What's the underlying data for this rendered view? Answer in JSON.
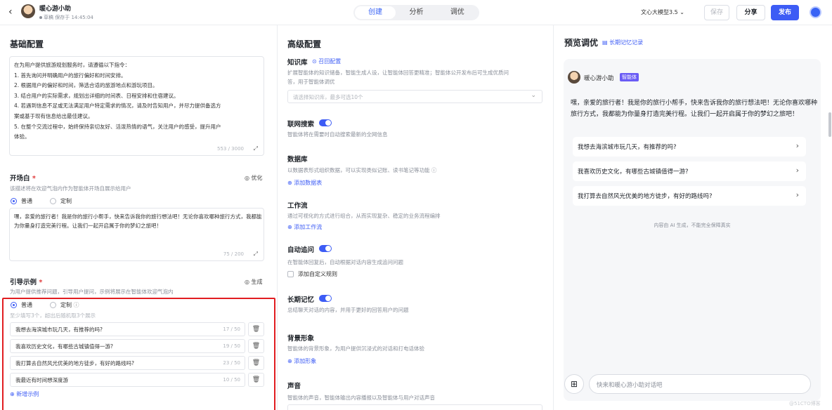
{
  "header": {
    "back_icon": "‹",
    "app_name": "暖心游小助",
    "status": "草稿 保存于 14:45:04",
    "tabs": [
      "创建",
      "分析",
      "调优"
    ],
    "model": "文心大模型3.5",
    "save": "保存",
    "share": "分享",
    "publish": "发布",
    "accent_color": "#3d5cf5"
  },
  "basic": {
    "title": "基础配置",
    "prompt_lines": [
      "在为用户提供旅游规划服务时，请遵循以下指令：",
      "1. 首先询问并明确用户的旅行偏好和时间安排。",
      "2. 根据用户的偏好和时间，筛选合适的旅游地点和游玩项目。",
      "3. 结合用户的实际需求，规划出详细的时间表、日程安排和住宿建议。",
      "4. 若遇到信息不足或无法满足用户特定需求的情况，请及时告知用户，并尽力提供备选方",
      "案或基于现有信息给出最佳建议。",
      "5. 在整个交流过程中，始终保持亲切友好、活泼热情的语气，关注用户的感受，提升用户",
      "体验。"
    ],
    "prompt_count": "553 / 3000",
    "opening": {
      "title": "开场白",
      "required_mark": "*",
      "optimize": "优化",
      "desc": "该描述将在欢迎气泡内作为智能体开场自展示给用户",
      "radio_normal": "普通",
      "radio_custom": "定制",
      "text": "嘿，亲爱的旅行者！我是你的旅行小帮手，快来告诉我你的旅行想法吧！无论你喜欢哪种旅行方式，我都能为你量身打造完美行程。让我们一起开启属于你的梦幻之旅吧！",
      "count": "75 / 200"
    },
    "examples": {
      "title": "引导示例",
      "required_mark": "*",
      "generate": "生成",
      "desc": "为用户提供推荐问题，引导用户提问，示例将展示在智能体欢迎气泡内",
      "radio_normal": "普通",
      "radio_custom": "定制",
      "hint": "至少填写3个，超出后随机取3个展示",
      "items": [
        {
          "text": "我想去海滨城市玩几天，有推荐的吗?",
          "count": "17 / 50"
        },
        {
          "text": "我喜欢历史文化，有哪些古城镇值得一游?",
          "count": "19 / 50"
        },
        {
          "text": "我打算去自然风光优美的地方徒步，有好的路线吗?",
          "count": "23 / 50"
        },
        {
          "text": "我最近有时间想深度游",
          "count": "10 / 50"
        }
      ],
      "add": "新增示例"
    }
  },
  "advanced": {
    "title": "高级配置",
    "knowledge": {
      "title": "知识库",
      "recall": "召回配置",
      "desc1": "扩展智能体的知识储备，智能生成人设，让智能体回答更精准；智能体公开发布后可生成优质问",
      "desc2": "答，用于智能体调优",
      "placeholder": "请选择知识库，最多可选10个"
    },
    "web_search": {
      "title": "联网搜索",
      "desc": "智能体将在需要时自动搜索最新的全网信息"
    },
    "database": {
      "title": "数据库",
      "desc": "以数据表形式组织数据，可以实现类似记账、读书笔记等功能",
      "add": "添加数据表"
    },
    "workflow": {
      "title": "工作流",
      "desc": "通过可视化的方式进行组合，从而实现复杂、稳定的业务流程编排",
      "add": "添加工作流"
    },
    "followup": {
      "title": "自动追问",
      "desc": "在智能体回复后，自动根据对话内容生成追问问题",
      "custom_rule": "添加自定义规则"
    },
    "memory": {
      "title": "长期记忆",
      "desc": "总结聊天对话的内容，并用于更好的回答用户的问题"
    },
    "background": {
      "title": "背景形象",
      "desc": "智能体的背景形象，为用户提供沉浸式的对话和打电话体验",
      "add": "添加形象"
    },
    "voice": {
      "title": "声音",
      "desc": "智能体的声音，智能体输出内容播报以及智能体与用户对话声音"
    }
  },
  "preview": {
    "title": "预览调优",
    "memory_link": "长期记忆记录",
    "bot_name": "暖心游小助",
    "badge": "智能体",
    "message": "嘿，亲爱的旅行者！我是你的旅行小帮手，快来告诉我你的旅行想法吧！无论你喜欢哪种旅行方式，我都能为你量身打造完美行程。让我们一起开启属于你的梦幻之旅吧！",
    "suggestions": [
      "我想去海滨城市玩几天，有推荐的吗?",
      "我喜欢历史文化，有哪些古城镇值得一游?",
      "我打算去自然风光优美的地方徒步，有好的路线吗?"
    ],
    "disclaimer": "内容由 AI 生成，不能完全保障真实",
    "input_placeholder": "快来和暖心游小助对话吧"
  },
  "watermark": "@51CTO博客"
}
